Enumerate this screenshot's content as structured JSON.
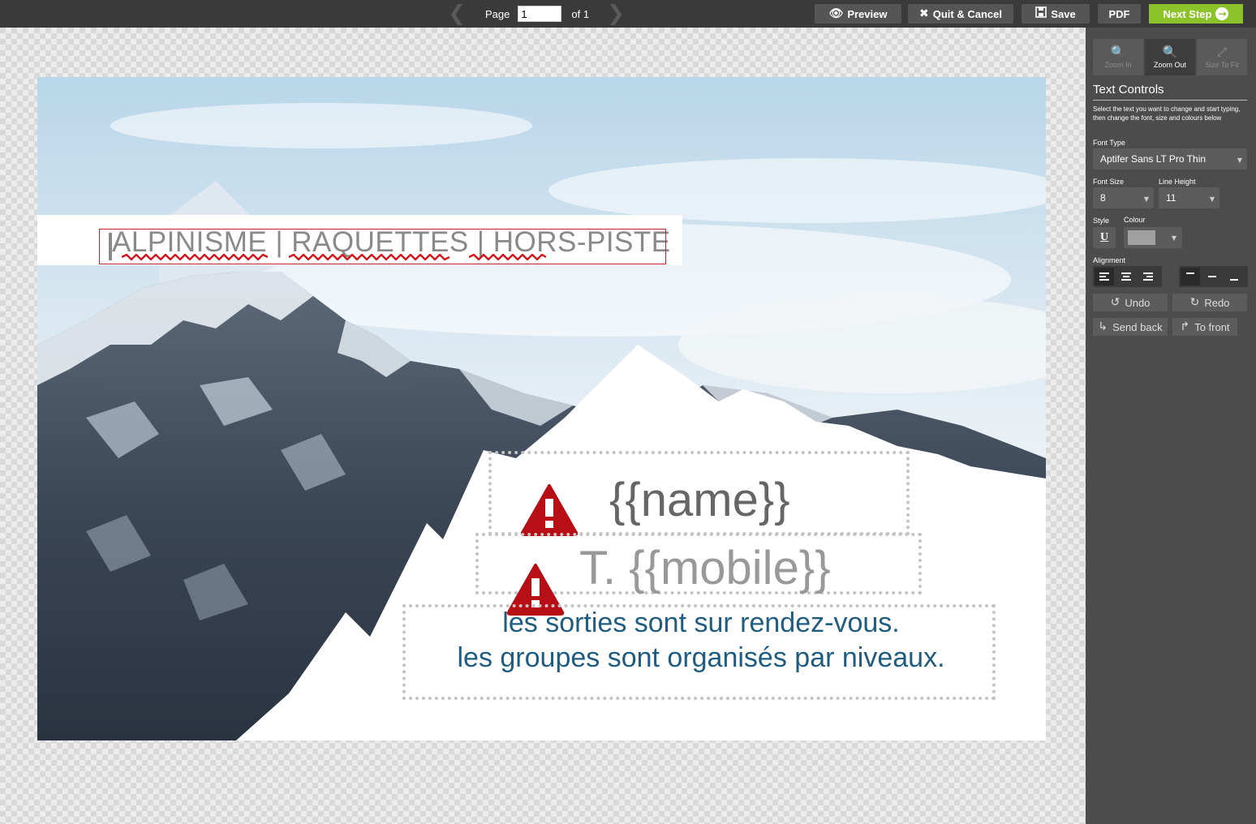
{
  "toolbar": {
    "page_label": "Page",
    "page_value": "1",
    "page_of": "of 1",
    "preview_label": "Preview",
    "quit_label": "Quit & Cancel",
    "save_label": "Save",
    "pdf_label": "PDF",
    "next_label": "Next Step",
    "accent_color": "#8cc22a"
  },
  "canvas": {
    "title_text": "ALPINISME | RAQUETTES | HORS-PISTE",
    "name_placeholder": "{{name}}",
    "mobile_placeholder": "T. {{mobile}}",
    "body_line1": "les sorties sont sur rendez-vous.",
    "body_line2": "les groupes sont organisés par niveaux.",
    "warning_icon": "warning-triangle-icon",
    "warning_color": "#b80f16",
    "body_color": "#1f5c82"
  },
  "panel": {
    "zoom_in_label": "Zoom In",
    "zoom_out_label": "Zoom Out",
    "size_to_fit_label": "Size To Fit",
    "title": "Text Controls",
    "help_text": "Select the text you want to change and start typing, then change the font, size and colours below",
    "font_type_label": "Font Type",
    "font_type_value": "Aptifer Sans LT Pro Thin",
    "font_size_label": "Font Size",
    "font_size_value": "8",
    "line_height_label": "Line Height",
    "line_height_value": "11",
    "style_label": "Style",
    "underline_label": "U",
    "colour_label": "Colour",
    "colour_value": "#a0a0a0",
    "alignment_label": "Alignment",
    "undo_label": "Undo",
    "redo_label": "Redo",
    "send_back_label": "Send back",
    "to_front_label": "To front"
  }
}
